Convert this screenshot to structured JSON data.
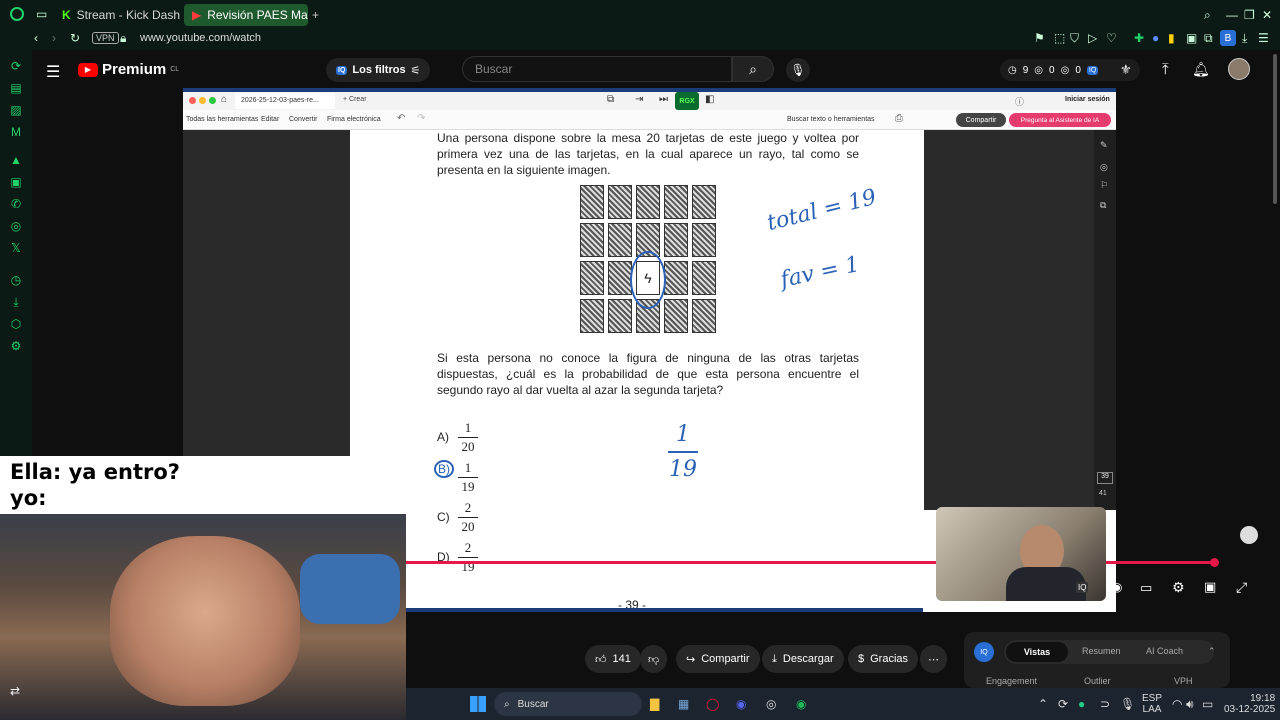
{
  "browser": {
    "tabs": [
      {
        "label": "Stream - Kick Dashboard",
        "icon": "kick-icon",
        "active": false
      },
      {
        "label": "Revisión PAES Matem",
        "icon": "youtube-icon",
        "active": true
      }
    ],
    "vpn_label": "VPN",
    "url": "www.youtube.com/watch"
  },
  "youtube": {
    "logo_text": "Premium",
    "region": "CL",
    "filters_label": "Los filtros",
    "search_placeholder": "Buscar",
    "stats": [
      "9",
      "0",
      "0"
    ]
  },
  "pdf": {
    "tab_label": "2026-25-12-03-paes-re...",
    "new_tab_label": "+ Crear",
    "signin_label": "Iniciar sesión",
    "toolbar": [
      "Todas las herramientas",
      "Editar",
      "Convertir",
      "Firma electrónica"
    ],
    "search_tools_label": "Buscar texto o herramientas",
    "share_label": "Compartir",
    "assistant_label": "Pregunta al Asistente de IA",
    "rgx_label": "RGX",
    "intro_text": "Una persona dispone sobre la mesa 20 tarjetas de este juego y voltea por primera vez una de las tarjetas, en la cual aparece un rayo, tal como se presenta en la siguiente imagen.",
    "question_text": "Si esta persona no conoce la figura de ninguna de las otras tarjetas dispuestas, ¿cuál es la probabilidad de que esta persona encuentre el segundo rayo al dar vuelta al azar la segunda tarjeta?",
    "options": [
      {
        "label": "A)",
        "num": "1",
        "den": "20"
      },
      {
        "label": "B)",
        "num": "1",
        "den": "19"
      },
      {
        "label": "C)",
        "num": "2",
        "den": "20"
      },
      {
        "label": "D)",
        "num": "2",
        "den": "19"
      }
    ],
    "page_number": "- 39 -",
    "handwriting": {
      "total": "total = 19",
      "fav": "fav = 1",
      "frac_num": "1",
      "frac_den": "19"
    },
    "page_counter": [
      "39",
      "41"
    ]
  },
  "meme": {
    "line1": "Ella: ya entro?",
    "line2": "yo:"
  },
  "video_actions": {
    "likes": "141",
    "share": "Compartir",
    "download": "Descargar",
    "thanks": "Gracias"
  },
  "analytics": {
    "tabs": [
      "Vistas",
      "Resumen",
      "AI Coach"
    ],
    "columns": [
      "Engagement",
      "Outlier",
      "VPH"
    ]
  },
  "taskbar": {
    "search_label": "Buscar",
    "lang": "ESP",
    "lang2": "LAA",
    "time": "19:18",
    "date": "03-12-2025"
  }
}
